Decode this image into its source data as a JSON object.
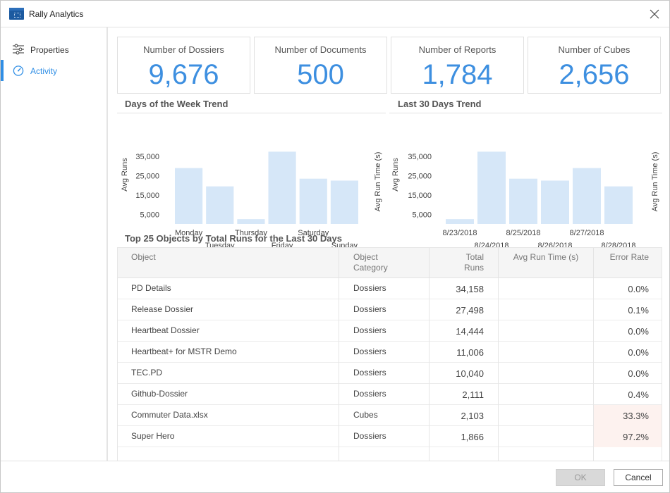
{
  "window": {
    "title": "Rally Analytics"
  },
  "sidebar": {
    "items": [
      {
        "label": "Properties",
        "icon": "sliders-icon",
        "active": false
      },
      {
        "label": "Activity",
        "icon": "speedometer-icon",
        "active": true
      }
    ]
  },
  "kpis": [
    {
      "label": "Number of Dossiers",
      "value": "9,676"
    },
    {
      "label": "Number of Documents",
      "value": "500"
    },
    {
      "label": "Number of Reports",
      "value": "1,784"
    },
    {
      "label": "Number of Cubes",
      "value": "2,656"
    }
  ],
  "colors": {
    "accent": "#3d8fe0",
    "bar": "#d6e7f8",
    "error_highlight": "#fdf2ef"
  },
  "chart_data": [
    {
      "type": "bar",
      "title": "Days of the Week Trend",
      "ylabel": "Avg Runs",
      "y2label": "Avg Run Time (s)",
      "yticks": [
        "35,000",
        "25,000",
        "15,000",
        "5,000"
      ],
      "ylim": [
        0,
        38000
      ],
      "categories": [
        "Monday",
        "Tuesday",
        "Thursday",
        "Friday",
        "Saturday",
        "Sunday"
      ],
      "values": [
        29000,
        19500,
        2500,
        37500,
        23500,
        22500
      ]
    },
    {
      "type": "bar",
      "title": "Last 30 Days Trend",
      "ylabel": "Avg Runs",
      "y2label": "Avg Run Time (s)",
      "yticks": [
        "35,000",
        "25,000",
        "15,000",
        "5,000"
      ],
      "ylim": [
        0,
        38000
      ],
      "categories": [
        "8/23/2018",
        "8/24/2018",
        "8/25/2018",
        "8/26/2018",
        "8/27/2018",
        "8/28/2018"
      ],
      "values": [
        2500,
        37500,
        23500,
        22500,
        29000,
        19500
      ]
    }
  ],
  "table": {
    "title": "Top 25 Objects by Total Runs for the Last 30 Days",
    "headers": {
      "object": "Object",
      "category_1": "Object",
      "category_2": "Category",
      "runs_1": "Total",
      "runs_2": "Runs",
      "avg_time": "Avg Run Time (s)",
      "error_rate": "Error Rate"
    },
    "rows": [
      {
        "object": "PD Details",
        "category": "Dossiers",
        "runs": "34,158",
        "avg_time": "",
        "error_rate": "0.0%",
        "highlight": false
      },
      {
        "object": "Release Dossier",
        "category": "Dossiers",
        "runs": "27,498",
        "avg_time": "",
        "error_rate": "0.1%",
        "highlight": false
      },
      {
        "object": "Heartbeat Dossier",
        "category": "Dossiers",
        "runs": "14,444",
        "avg_time": "",
        "error_rate": "0.0%",
        "highlight": false
      },
      {
        "object": "Heartbeat+ for MSTR Demo",
        "category": "Dossiers",
        "runs": "11,006",
        "avg_time": "",
        "error_rate": "0.0%",
        "highlight": false
      },
      {
        "object": "TEC.PD",
        "category": "Dossiers",
        "runs": "10,040",
        "avg_time": "",
        "error_rate": "0.0%",
        "highlight": false
      },
      {
        "object": "Github-Dossier",
        "category": "Dossiers",
        "runs": "2,111",
        "avg_time": "",
        "error_rate": "0.4%",
        "highlight": false
      },
      {
        "object": "Commuter Data.xlsx",
        "category": "Cubes",
        "runs": "2,103",
        "avg_time": "",
        "error_rate": "33.3%",
        "highlight": true
      },
      {
        "object": "Super Hero",
        "category": "Dossiers",
        "runs": "1,866",
        "avg_time": "",
        "error_rate": "97.2%",
        "highlight": true
      }
    ]
  },
  "footer": {
    "ok_label": "OK",
    "cancel_label": "Cancel"
  }
}
